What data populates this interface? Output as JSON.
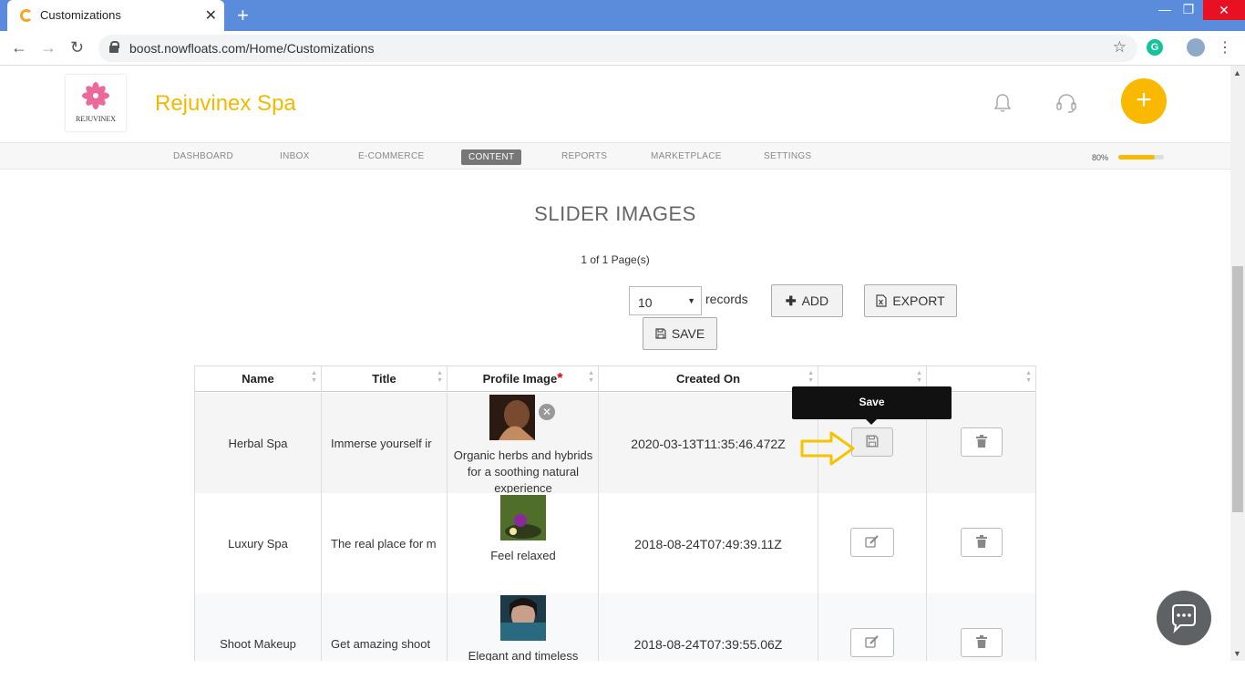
{
  "browser": {
    "tab_title": "Customizations",
    "tab_close": "✕",
    "new_tab": "+",
    "url": "boost.nowfloats.com/Home/Customizations",
    "win_minimize": "—",
    "win_restore": "❐",
    "win_close": "✕",
    "back": "←",
    "forward": "→",
    "reload": "↻",
    "star": "☆",
    "ext_label": "G",
    "menu": "⋮"
  },
  "header": {
    "logo_text": "REJUVINEX",
    "brand": "Rejuvinex Spa",
    "fab_label": "+"
  },
  "nav": {
    "items": [
      {
        "label": "DASHBOARD"
      },
      {
        "label": "INBOX"
      },
      {
        "label": "E-COMMERCE"
      },
      {
        "label": "CONTENT"
      },
      {
        "label": "REPORTS"
      },
      {
        "label": "MARKETPLACE"
      },
      {
        "label": "SETTINGS"
      }
    ],
    "active": "CONTENT",
    "progress_label": "80%",
    "progress_value": 0.8
  },
  "section": {
    "title": "SLIDER IMAGES",
    "pages": "1 of 1 Page(s)"
  },
  "controls": {
    "page_size": "10",
    "records_label": "records",
    "add_label": "ADD",
    "export_label": "EXPORT",
    "save_label": "SAVE"
  },
  "table": {
    "headers": [
      "Name",
      "Title",
      "Profile Image",
      "Created On"
    ],
    "required_mark": "*",
    "rows": [
      {
        "name": "Herbal Spa",
        "title": "Immerse yourself ir",
        "caption": "Organic herbs and hybrids for a soothing natural experience",
        "created": "2020-03-13T11:35:46.472Z"
      },
      {
        "name": "Luxury Spa",
        "title": "The real place for m",
        "caption": "Feel relaxed",
        "created": "2018-08-24T07:49:39.11Z"
      },
      {
        "name": "Shoot Makeup",
        "title": "Get amazing shoot",
        "caption": "Elegant and timeless",
        "created": "2018-08-24T07:39:55.06Z"
      }
    ]
  },
  "tooltip": {
    "text": "Save"
  },
  "colors": {
    "brand": "#f5b800",
    "browser_bar": "#5b8bdb",
    "annotation_arrow": "#f5c400"
  }
}
